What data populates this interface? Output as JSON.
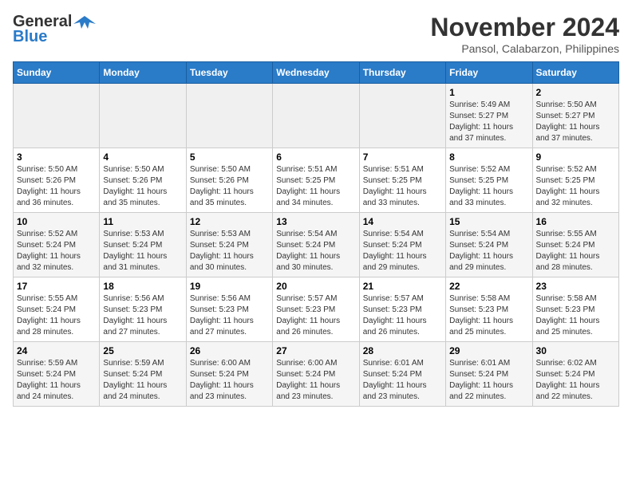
{
  "header": {
    "logo_line1": "General",
    "logo_line2": "Blue",
    "month": "November 2024",
    "location": "Pansol, Calabarzon, Philippines"
  },
  "weekdays": [
    "Sunday",
    "Monday",
    "Tuesday",
    "Wednesday",
    "Thursday",
    "Friday",
    "Saturday"
  ],
  "weeks": [
    [
      {
        "day": "",
        "info": ""
      },
      {
        "day": "",
        "info": ""
      },
      {
        "day": "",
        "info": ""
      },
      {
        "day": "",
        "info": ""
      },
      {
        "day": "",
        "info": ""
      },
      {
        "day": "1",
        "info": "Sunrise: 5:49 AM\nSunset: 5:27 PM\nDaylight: 11 hours\nand 37 minutes."
      },
      {
        "day": "2",
        "info": "Sunrise: 5:50 AM\nSunset: 5:27 PM\nDaylight: 11 hours\nand 37 minutes."
      }
    ],
    [
      {
        "day": "3",
        "info": "Sunrise: 5:50 AM\nSunset: 5:26 PM\nDaylight: 11 hours\nand 36 minutes."
      },
      {
        "day": "4",
        "info": "Sunrise: 5:50 AM\nSunset: 5:26 PM\nDaylight: 11 hours\nand 35 minutes."
      },
      {
        "day": "5",
        "info": "Sunrise: 5:50 AM\nSunset: 5:26 PM\nDaylight: 11 hours\nand 35 minutes."
      },
      {
        "day": "6",
        "info": "Sunrise: 5:51 AM\nSunset: 5:25 PM\nDaylight: 11 hours\nand 34 minutes."
      },
      {
        "day": "7",
        "info": "Sunrise: 5:51 AM\nSunset: 5:25 PM\nDaylight: 11 hours\nand 33 minutes."
      },
      {
        "day": "8",
        "info": "Sunrise: 5:52 AM\nSunset: 5:25 PM\nDaylight: 11 hours\nand 33 minutes."
      },
      {
        "day": "9",
        "info": "Sunrise: 5:52 AM\nSunset: 5:25 PM\nDaylight: 11 hours\nand 32 minutes."
      }
    ],
    [
      {
        "day": "10",
        "info": "Sunrise: 5:52 AM\nSunset: 5:24 PM\nDaylight: 11 hours\nand 32 minutes."
      },
      {
        "day": "11",
        "info": "Sunrise: 5:53 AM\nSunset: 5:24 PM\nDaylight: 11 hours\nand 31 minutes."
      },
      {
        "day": "12",
        "info": "Sunrise: 5:53 AM\nSunset: 5:24 PM\nDaylight: 11 hours\nand 30 minutes."
      },
      {
        "day": "13",
        "info": "Sunrise: 5:54 AM\nSunset: 5:24 PM\nDaylight: 11 hours\nand 30 minutes."
      },
      {
        "day": "14",
        "info": "Sunrise: 5:54 AM\nSunset: 5:24 PM\nDaylight: 11 hours\nand 29 minutes."
      },
      {
        "day": "15",
        "info": "Sunrise: 5:54 AM\nSunset: 5:24 PM\nDaylight: 11 hours\nand 29 minutes."
      },
      {
        "day": "16",
        "info": "Sunrise: 5:55 AM\nSunset: 5:24 PM\nDaylight: 11 hours\nand 28 minutes."
      }
    ],
    [
      {
        "day": "17",
        "info": "Sunrise: 5:55 AM\nSunset: 5:24 PM\nDaylight: 11 hours\nand 28 minutes."
      },
      {
        "day": "18",
        "info": "Sunrise: 5:56 AM\nSunset: 5:23 PM\nDaylight: 11 hours\nand 27 minutes."
      },
      {
        "day": "19",
        "info": "Sunrise: 5:56 AM\nSunset: 5:23 PM\nDaylight: 11 hours\nand 27 minutes."
      },
      {
        "day": "20",
        "info": "Sunrise: 5:57 AM\nSunset: 5:23 PM\nDaylight: 11 hours\nand 26 minutes."
      },
      {
        "day": "21",
        "info": "Sunrise: 5:57 AM\nSunset: 5:23 PM\nDaylight: 11 hours\nand 26 minutes."
      },
      {
        "day": "22",
        "info": "Sunrise: 5:58 AM\nSunset: 5:23 PM\nDaylight: 11 hours\nand 25 minutes."
      },
      {
        "day": "23",
        "info": "Sunrise: 5:58 AM\nSunset: 5:23 PM\nDaylight: 11 hours\nand 25 minutes."
      }
    ],
    [
      {
        "day": "24",
        "info": "Sunrise: 5:59 AM\nSunset: 5:24 PM\nDaylight: 11 hours\nand 24 minutes."
      },
      {
        "day": "25",
        "info": "Sunrise: 5:59 AM\nSunset: 5:24 PM\nDaylight: 11 hours\nand 24 minutes."
      },
      {
        "day": "26",
        "info": "Sunrise: 6:00 AM\nSunset: 5:24 PM\nDaylight: 11 hours\nand 23 minutes."
      },
      {
        "day": "27",
        "info": "Sunrise: 6:00 AM\nSunset: 5:24 PM\nDaylight: 11 hours\nand 23 minutes."
      },
      {
        "day": "28",
        "info": "Sunrise: 6:01 AM\nSunset: 5:24 PM\nDaylight: 11 hours\nand 23 minutes."
      },
      {
        "day": "29",
        "info": "Sunrise: 6:01 AM\nSunset: 5:24 PM\nDaylight: 11 hours\nand 22 minutes."
      },
      {
        "day": "30",
        "info": "Sunrise: 6:02 AM\nSunset: 5:24 PM\nDaylight: 11 hours\nand 22 minutes."
      }
    ]
  ]
}
